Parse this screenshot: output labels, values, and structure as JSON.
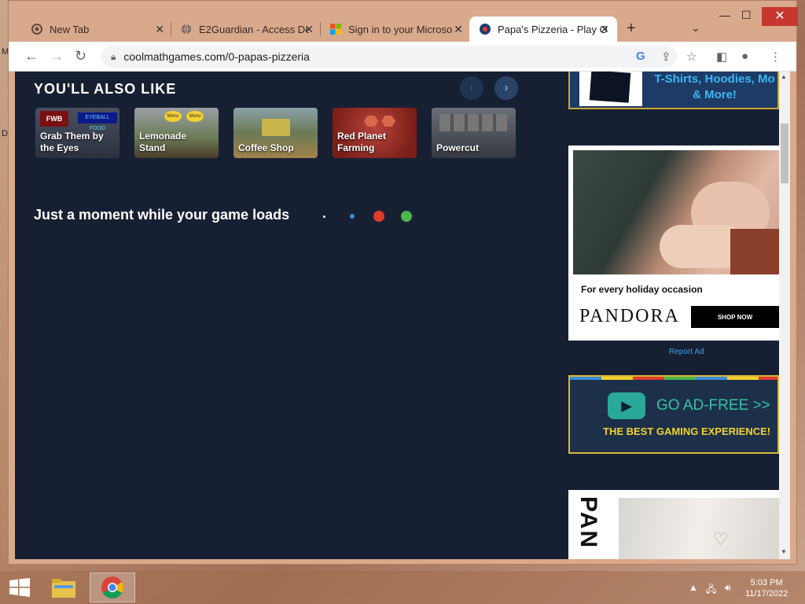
{
  "desktop": {
    "stray_left_1": "M",
    "stray_left_2": "D"
  },
  "browser": {
    "tabs": [
      {
        "title": "New Tab",
        "icon": "chrome-icon"
      },
      {
        "title": "E2Guardian - Access De",
        "icon": "globe-icon"
      },
      {
        "title": "Sign in to your Microso",
        "icon": "microsoft-icon"
      },
      {
        "title": "Papa's Pizzeria - Play O",
        "icon": "coolmath-icon",
        "active": true
      }
    ],
    "url": "coolmathgames.com/0-papas-pizzeria",
    "window_controls": {
      "minimize": "—",
      "maximize": "☐",
      "close": "✕"
    }
  },
  "page": {
    "section_title": "YOU'LL ALSO LIKE",
    "games": [
      {
        "name": "Grab Them by the Eyes",
        "line1": "Grab Them by",
        "line2": "the Eyes",
        "color": "#3a4150"
      },
      {
        "name": "Lemonade Stand",
        "line1": "Lemonade",
        "line2": "Stand",
        "color": "#5a6a3a"
      },
      {
        "name": "Coffee Shop",
        "line1": "",
        "line2": "Coffee Shop",
        "color": "#6b7a55"
      },
      {
        "name": "Red Planet Farming",
        "line1": "Red Planet",
        "line2": "Farming",
        "color": "#8b2c22"
      },
      {
        "name": "Powercut",
        "line1": "",
        "line2": "Powercut",
        "color": "#4a4e57"
      }
    ],
    "loading_text": "Just a moment while your game loads",
    "dot_colors": [
      "#ffffff",
      "#3a8fd6",
      "#e03c2b",
      "#4cb84a"
    ],
    "thumb_badges": {
      "grab_badge": "FWB",
      "grab_sign": "EYEBALL FOOD",
      "lemon_badge_1": "Menu",
      "lemon_badge_2": "Menu"
    }
  },
  "ads": {
    "shirts_text_1": "T-Shirts, Hoodies, Mo",
    "shirts_text_2": "& More!",
    "pandora_tagline": "For every holiday occasion",
    "pandora_logo": "PANDORA",
    "pandora_cta": "SHOP NOW",
    "report_ad": "Report Ad",
    "adfree_title": "GO AD-FREE >>",
    "adfree_sub": "THE BEST GAMING EXPERIENCE!",
    "bottom_brand": "PAN",
    "stripe_colors": [
      "#3a8fd6",
      "#f3d12e",
      "#e03c2b",
      "#4cb84a",
      "#3a8fd6",
      "#f3d12e",
      "#e03c2b"
    ]
  },
  "taskbar": {
    "time": "5:03 PM",
    "date": "11/17/2022"
  }
}
